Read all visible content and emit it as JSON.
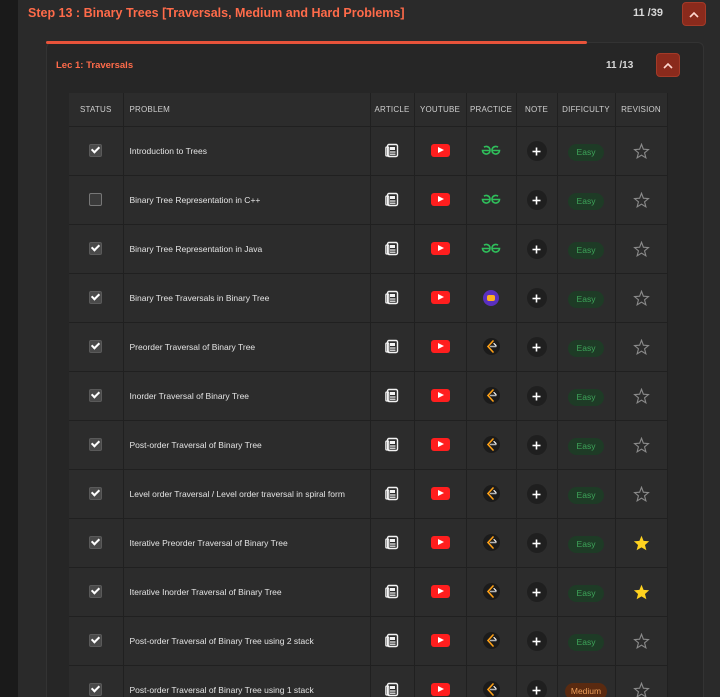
{
  "step": {
    "title": "Step 13 : Binary Trees [Traversals, Medium and Hard Problems]",
    "count": "11 /39"
  },
  "lecture": {
    "title": "Lec 1: Traversals",
    "count": "11 /13",
    "progress_fraction": 0.85
  },
  "columns": {
    "status": "STATUS",
    "problem": "PROBLEM",
    "article": "ARTICLE",
    "youtube": "YOUTUBE",
    "practice": "PRACTICE",
    "note": "NOTE",
    "difficulty": "DIFFICULTY",
    "revision": "REVISION"
  },
  "colors": {
    "accent": "#ff6b4a",
    "easy": "#3ea55a",
    "medium": "#f0a05a",
    "youtube": "#ff1e1e",
    "star_active": "#ffd21f"
  },
  "rows": [
    {
      "done": true,
      "problem": "Introduction to Trees",
      "practice": "gfg",
      "difficulty": "Easy",
      "starred": false
    },
    {
      "done": false,
      "problem": "Binary Tree Representation in C++",
      "practice": "gfg",
      "difficulty": "Easy",
      "starred": false
    },
    {
      "done": true,
      "problem": "Binary Tree Representation in Java",
      "practice": "gfg",
      "difficulty": "Easy",
      "starred": false
    },
    {
      "done": true,
      "problem": "Binary Tree Traversals in Binary Tree",
      "practice": "codestudio",
      "difficulty": "Easy",
      "starred": false
    },
    {
      "done": true,
      "problem": "Preorder Traversal of Binary Tree",
      "practice": "leetcode",
      "difficulty": "Easy",
      "starred": false
    },
    {
      "done": true,
      "problem": "Inorder Traversal of Binary Tree",
      "practice": "leetcode",
      "difficulty": "Easy",
      "starred": false
    },
    {
      "done": true,
      "problem": "Post-order Traversal of Binary Tree",
      "practice": "leetcode",
      "difficulty": "Easy",
      "starred": false
    },
    {
      "done": true,
      "problem": "Level order Traversal / Level order traversal in spiral form",
      "practice": "leetcode",
      "difficulty": "Easy",
      "starred": false
    },
    {
      "done": true,
      "problem": "Iterative Preorder Traversal of Binary Tree",
      "practice": "leetcode",
      "difficulty": "Easy",
      "starred": true
    },
    {
      "done": true,
      "problem": "Iterative Inorder Traversal of Binary Tree",
      "practice": "leetcode",
      "difficulty": "Easy",
      "starred": true
    },
    {
      "done": true,
      "problem": "Post-order Traversal of Binary Tree using 2 stack",
      "practice": "leetcode",
      "difficulty": "Easy",
      "starred": false
    },
    {
      "done": true,
      "problem": "Post-order Traversal of Binary Tree using 1 stack",
      "practice": "leetcode",
      "difficulty": "Medium",
      "starred": false
    }
  ]
}
